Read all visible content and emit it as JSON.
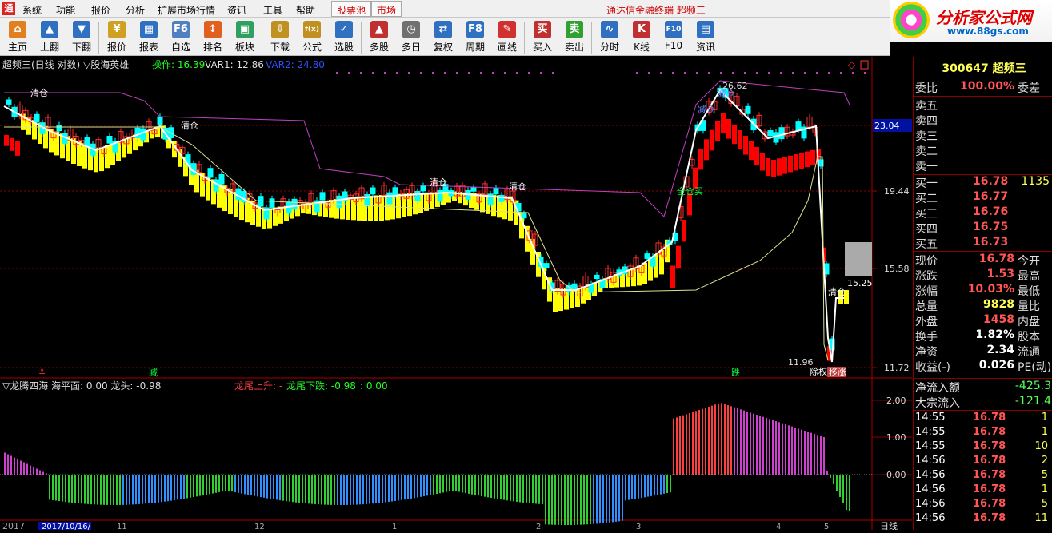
{
  "menu": {
    "items": [
      "系统",
      "功能",
      "报价",
      "分析",
      "扩展市场行情",
      "资讯",
      "工具",
      "帮助"
    ],
    "tabs": [
      "股票池",
      "市场"
    ],
    "title": "通达信金融终端  超频三"
  },
  "brand": {
    "name": "分析家公式网",
    "url": "www.88gs.com"
  },
  "toolbar": {
    "buttons": [
      {
        "label": "主页",
        "icon": "home-icon"
      },
      {
        "label": "上翻",
        "icon": "page-up-icon"
      },
      {
        "label": "下翻",
        "icon": "page-down-icon"
      },
      {
        "label": "报价",
        "icon": "quote-icon"
      },
      {
        "label": "报表",
        "icon": "report-icon"
      },
      {
        "label": "自选",
        "icon": "watchlist-icon"
      },
      {
        "label": "排名",
        "icon": "ranking-icon"
      },
      {
        "label": "板块",
        "icon": "sector-icon"
      },
      {
        "label": "下载",
        "icon": "download-icon"
      },
      {
        "label": "公式",
        "icon": "formula-icon"
      },
      {
        "label": "选股",
        "icon": "stock-picker-icon"
      },
      {
        "label": "多股",
        "icon": "multi-stock-icon"
      },
      {
        "label": "多日",
        "icon": "multi-day-icon"
      },
      {
        "label": "复权",
        "icon": "adjust-icon"
      },
      {
        "label": "周期",
        "icon": "period-icon"
      },
      {
        "label": "画线",
        "icon": "draw-line-icon"
      },
      {
        "label": "买入",
        "icon": "buy-icon"
      },
      {
        "label": "卖出",
        "icon": "sell-icon"
      },
      {
        "label": "分时",
        "icon": "intraday-icon"
      },
      {
        "label": "K线",
        "icon": "kline-icon"
      },
      {
        "label": "F10",
        "icon": "f10-icon"
      },
      {
        "label": "资讯",
        "icon": "news-icon"
      }
    ]
  },
  "main_chart": {
    "header": "超频三(日线 对数) ▽股海英雄",
    "op_label": "操作: 16.39",
    "var1": "VAR1: 12.86",
    "var2": "VAR2: 24.80",
    "price_axis": [
      "23.04",
      "19.44",
      "15.58",
      "11.72"
    ],
    "price_axis_box": "23.04",
    "annotations": {
      "high": "26.62",
      "low": "11.96",
      "right_price": "15.25",
      "clear": "清仓",
      "reduce": "减仓",
      "full_buy": "全仓买",
      "reduce_bottom": "减",
      "fall_bottom": "跌",
      "event1": "除权",
      "event2": "移涨"
    },
    "colors": {
      "bull": "#ff3030",
      "bear": "#00ffff",
      "band_up": "#ffff00",
      "band_down": "#ff0000",
      "upper_line": "#c040c0"
    }
  },
  "sub_chart": {
    "header": "▽龙腾四海  海平面: 0.00  龙头: -0.98",
    "rise": "龙尾上升: -",
    "fall": "龙尾下跌: -0.98",
    "extra": ": 0.00",
    "axis": [
      "2.00",
      "1.00",
      "0.00"
    ]
  },
  "date_axis": {
    "left": "2017",
    "box": "2017/10/16/",
    "ticks": [
      "11",
      "12",
      "1",
      "2",
      "3",
      "4",
      "5"
    ],
    "right": "日线"
  },
  "chart_data": {
    "type": "candlestick",
    "ylim": [
      11.72,
      26.62
    ],
    "log_scale": true,
    "high": 26.62,
    "low": 11.96
  },
  "right_panel": {
    "code_name": "300647 超频三",
    "ratio_label": "委比",
    "ratio_value": "100.00%",
    "diff_label": "委差",
    "sell": [
      "卖五",
      "卖四",
      "卖三",
      "卖二",
      "卖一"
    ],
    "buy": [
      {
        "label": "买一",
        "price": "16.78",
        "vol": "1135"
      },
      {
        "label": "买二",
        "price": "16.77",
        "vol": ""
      },
      {
        "label": "买三",
        "price": "16.76",
        "vol": ""
      },
      {
        "label": "买四",
        "price": "16.75",
        "vol": ""
      },
      {
        "label": "买五",
        "price": "16.73",
        "vol": ""
      }
    ],
    "quote": [
      {
        "l1": "现价",
        "v1": "16.78",
        "l2": "今开",
        "c": "red"
      },
      {
        "l1": "涨跌",
        "v1": "1.53",
        "l2": "最高",
        "c": "red"
      },
      {
        "l1": "涨幅",
        "v1": "10.03%",
        "l2": "最低",
        "c": "red"
      },
      {
        "l1": "总量",
        "v1": "9828",
        "l2": "量比",
        "c": "yel"
      },
      {
        "l1": "外盘",
        "v1": "1458",
        "l2": "内盘",
        "c": "red"
      },
      {
        "l1": "换手",
        "v1": "1.82%",
        "l2": "股本",
        "c": "wht"
      },
      {
        "l1": "净资",
        "v1": "2.34",
        "l2": "流通",
        "c": "wht"
      },
      {
        "l1": "收益(-)",
        "v1": "0.026",
        "l2": "PE(动)",
        "c": "wht"
      }
    ],
    "flow": [
      {
        "label": "净流入额",
        "value": "-425.3"
      },
      {
        "label": "大宗流入",
        "value": "-121.4"
      }
    ],
    "ticks": [
      {
        "t": "14:55",
        "p": "16.78",
        "v": "1"
      },
      {
        "t": "14:55",
        "p": "16.78",
        "v": "1"
      },
      {
        "t": "14:55",
        "p": "16.78",
        "v": "10"
      },
      {
        "t": "14:56",
        "p": "16.78",
        "v": "2"
      },
      {
        "t": "14:56",
        "p": "16.78",
        "v": "5"
      },
      {
        "t": "14:56",
        "p": "16.78",
        "v": "1"
      },
      {
        "t": "14:56",
        "p": "16.78",
        "v": "5"
      },
      {
        "t": "14:56",
        "p": "16.78",
        "v": "11"
      }
    ]
  }
}
